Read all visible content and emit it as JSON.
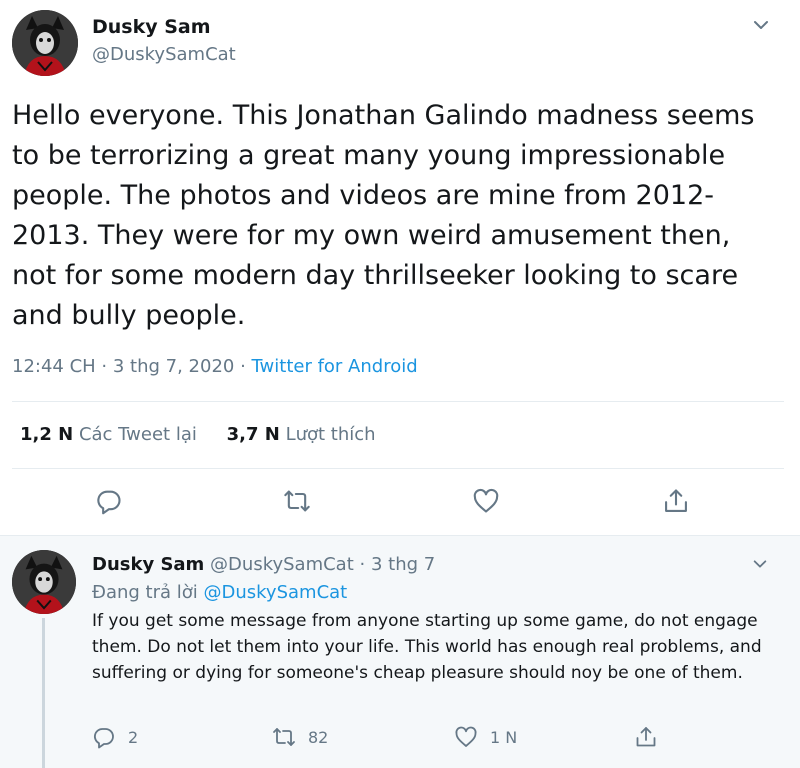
{
  "main_tweet": {
    "author_name": "Dusky Sam",
    "author_handle": "@DuskySamCat",
    "text": "Hello everyone. This Jonathan Galindo madness seems to be terrorizing a great many young impressionable people. The photos and videos are mine from 2012-2013. They were for my own weird amusement then, not for some modern day thrillseeker looking to scare and bully people.",
    "timestamp": "12:44 CH · 3 thg 7, 2020",
    "separator": " · ",
    "source": "Twitter for Android",
    "retweets_count": "1,2 N",
    "retweets_label": "Các Tweet lại",
    "likes_count": "3,7 N",
    "likes_label": "Lượt thích",
    "icons": [
      "reply-icon",
      "retweet-icon",
      "like-icon",
      "share-icon"
    ]
  },
  "reply_tweet": {
    "author_name": "Dusky Sam",
    "author_handle": "@DuskySamCat",
    "date": "· 3 thg 7",
    "replying_label": "Đang trả lời",
    "replying_to": "@DuskySamCat",
    "text": "If you get some message from anyone starting up some game, do not engage them. Do not let them into your life. This world has enough real problems, and suffering or dying for someone's cheap pleasure should noy be one of them.",
    "reply_count": "2",
    "retweet_count": "82",
    "like_count": "1 N"
  },
  "colors": {
    "text_primary": "#14171a",
    "text_secondary": "#657786",
    "link": "#1b95e0",
    "divider": "#e6ecf0",
    "reply_background": "#f5f8fa"
  }
}
